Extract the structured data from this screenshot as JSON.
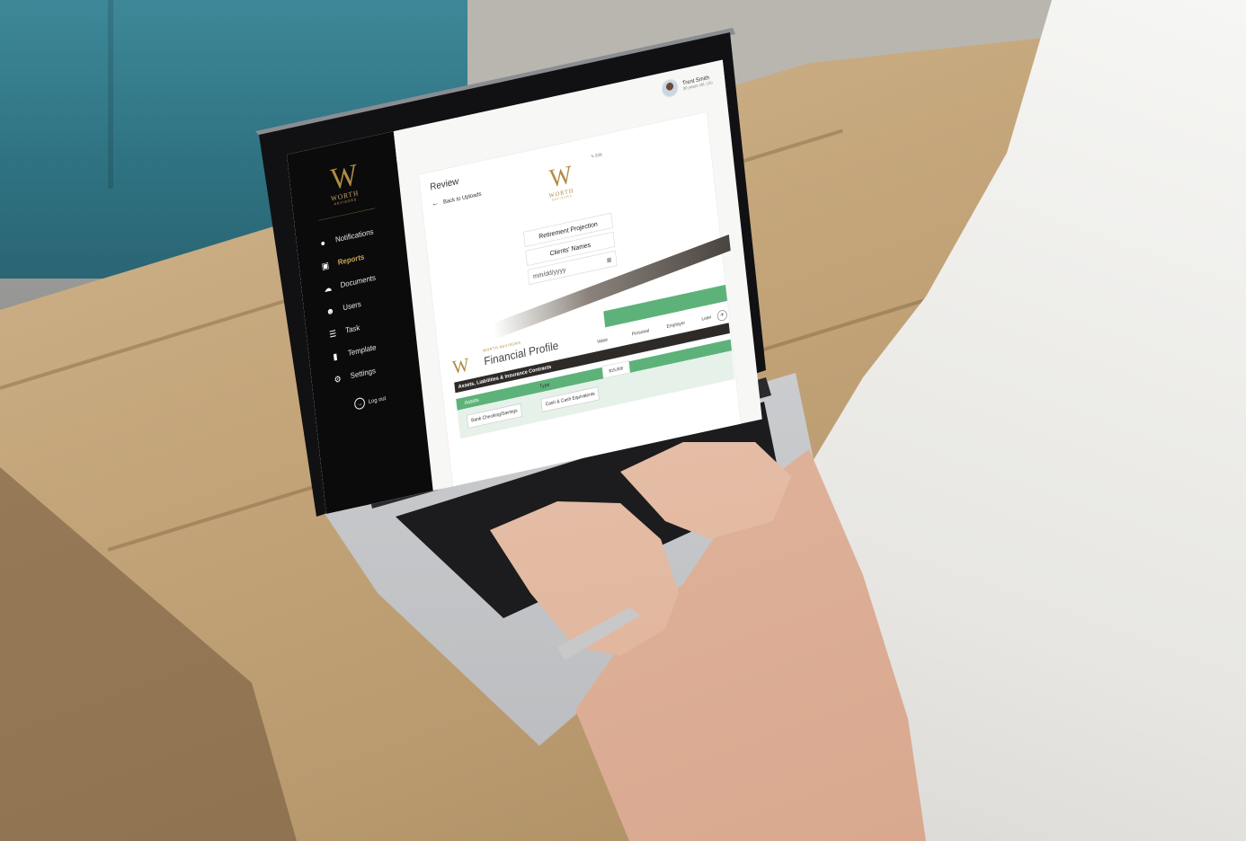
{
  "sidebar": {
    "logo": {
      "mark": "W",
      "name": "WORTH",
      "sub": "ADVISORS"
    },
    "items": [
      {
        "label": "Notifications",
        "icon": "bell-icon"
      },
      {
        "label": "Reports",
        "icon": "chart-icon",
        "active": true
      },
      {
        "label": "Documents",
        "icon": "cloud-upload-icon"
      },
      {
        "label": "Users",
        "icon": "user-icon"
      },
      {
        "label": "Task",
        "icon": "checklist-icon"
      },
      {
        "label": "Template",
        "icon": "file-icon"
      },
      {
        "label": "Settings",
        "icon": "gear-icon"
      }
    ],
    "logout": "Log out"
  },
  "user": {
    "name": "Trent Smith",
    "meta": "30 years old, Lilo"
  },
  "review": {
    "title": "Review",
    "back": "Back to Uploads",
    "edit": "Edit",
    "logo": {
      "mark": "W",
      "name": "WORTH",
      "sub": "ADVISORS"
    },
    "report_title": "Retirement Projection",
    "client_names": "Clients' Names",
    "date_placeholder": "mm/dd/yyyy"
  },
  "financial_profile": {
    "brand": "WORTH ADVISORS",
    "title": "Financial Profile",
    "section": "Assets, Liabilities & Insurance Contracts",
    "columns": [
      "Value",
      "Personal",
      "Employer",
      "Loan"
    ],
    "row_label": "Assets",
    "row_type": "Type",
    "row_value": "$15,000",
    "chips": [
      "Bank Checking/Savings",
      "Cash & Cash Equivalents"
    ]
  },
  "colors": {
    "sidebar": "#0b0b0b",
    "gold": "#b18b45",
    "green": "#5db27a"
  }
}
